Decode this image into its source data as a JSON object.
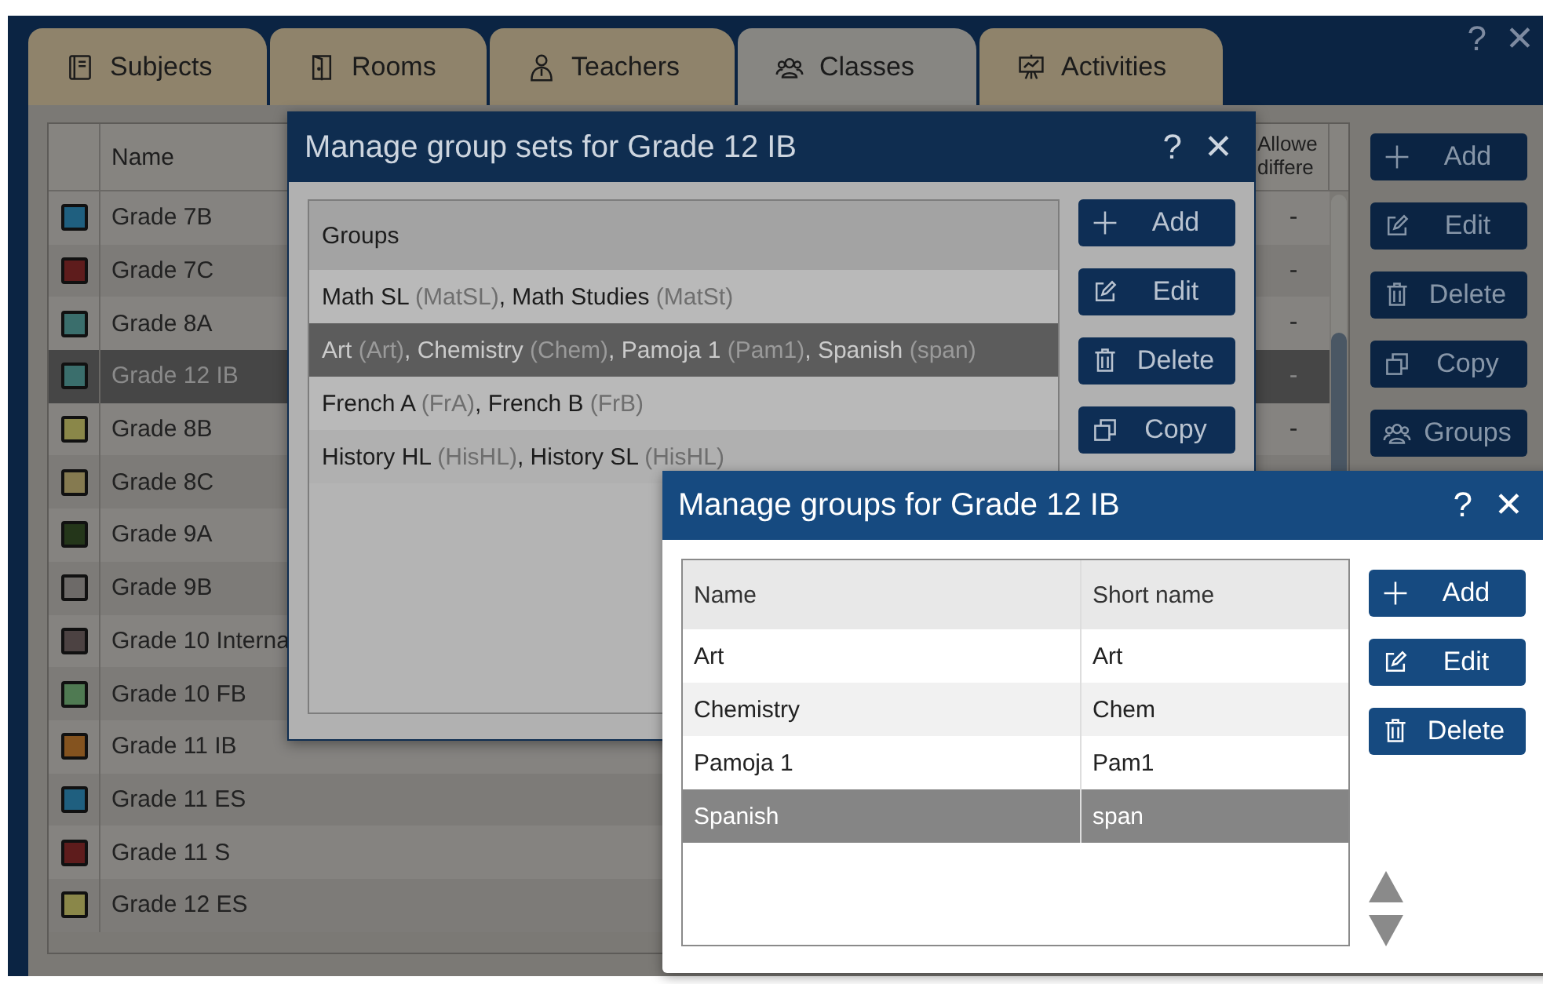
{
  "window": {
    "help": "?",
    "close": "✕"
  },
  "tabs": [
    {
      "label": "Subjects",
      "kind": "book",
      "selected": false
    },
    {
      "label": "Rooms",
      "kind": "door",
      "selected": false
    },
    {
      "label": "Teachers",
      "kind": "person",
      "selected": false
    },
    {
      "label": "Classes",
      "kind": "people",
      "selected": true
    },
    {
      "label": "Activities",
      "kind": "easel",
      "selected": false
    }
  ],
  "classes_table": {
    "columns": [
      "Name",
      "Allowe differe"
    ],
    "rows": [
      {
        "name": "Grade 7B",
        "color": "#1f5f7f",
        "selected": false,
        "column_2": "-"
      },
      {
        "name": "Grade 7C",
        "color": "#5e1c1c",
        "selected": false,
        "column_2": "-"
      },
      {
        "name": "Grade 8A",
        "color": "#3a6e6c",
        "selected": false,
        "column_2": "-"
      },
      {
        "name": "Grade 12 IB",
        "color": "#3a6e6c",
        "selected": true,
        "column_2": "-"
      },
      {
        "name": "Grade 8B",
        "color": "#8a8749",
        "selected": false,
        "column_2": "-"
      },
      {
        "name": "Grade 8C",
        "color": "#857a50",
        "selected": false
      },
      {
        "name": "Grade 9A",
        "color": "#24361a",
        "selected": false
      },
      {
        "name": "Grade 9B",
        "color": "#6d6a68",
        "selected": false
      },
      {
        "name": "Grade 10 Interna",
        "color": "#4c4242",
        "selected": false
      },
      {
        "name": "Grade 10 FB",
        "color": "#4f7a52",
        "selected": false
      },
      {
        "name": "Grade 11 IB",
        "color": "#84531f",
        "selected": false
      },
      {
        "name": "Grade 11 ES",
        "color": "#1f5f7f",
        "selected": false
      },
      {
        "name": "Grade 11 S",
        "color": "#5e1c1c",
        "selected": false
      },
      {
        "name": "Grade 12 ES",
        "color": "#8a8749",
        "selected": false
      }
    ]
  },
  "class_buttons": [
    {
      "label": "Add",
      "kind": "plus"
    },
    {
      "label": "Edit",
      "kind": "edit"
    },
    {
      "label": "Delete",
      "kind": "trash"
    },
    {
      "label": "Copy",
      "kind": "copy"
    },
    {
      "label": "Groups",
      "kind": "people"
    }
  ],
  "group_sets_dialog": {
    "title": "Manage group sets for Grade 12 IB",
    "help": "?",
    "close": "✕",
    "column": "Groups",
    "rows": [
      {
        "selected": false,
        "parts": [
          {
            "text": "Math SL ",
            "muted": false
          },
          {
            "text": "(MatSL)",
            "muted": true
          },
          {
            "text": ", Math Studies ",
            "muted": false
          },
          {
            "text": "(MatSt)",
            "muted": true
          }
        ]
      },
      {
        "selected": true,
        "parts": [
          {
            "text": "Art ",
            "muted": false
          },
          {
            "text": "(Art)",
            "muted": true
          },
          {
            "text": ", Chemistry ",
            "muted": false
          },
          {
            "text": "(Chem)",
            "muted": true
          },
          {
            "text": ", Pamoja 1 ",
            "muted": false
          },
          {
            "text": "(Pam1)",
            "muted": true
          },
          {
            "text": ", Spanish ",
            "muted": false
          },
          {
            "text": "(span)",
            "muted": true
          }
        ]
      },
      {
        "selected": false,
        "parts": [
          {
            "text": "French A ",
            "muted": false
          },
          {
            "text": "(FrA)",
            "muted": true
          },
          {
            "text": ", French B ",
            "muted": false
          },
          {
            "text": "(FrB)",
            "muted": true
          }
        ]
      },
      {
        "selected": false,
        "parts": [
          {
            "text": "History HL ",
            "muted": false
          },
          {
            "text": "(HisHL)",
            "muted": true
          },
          {
            "text": ", History SL ",
            "muted": false
          },
          {
            "text": "(HisHL)",
            "muted": true
          }
        ]
      }
    ],
    "buttons": [
      {
        "label": "Add",
        "kind": "plus"
      },
      {
        "label": "Edit",
        "kind": "edit"
      },
      {
        "label": "Delete",
        "kind": "trash"
      },
      {
        "label": "Copy",
        "kind": "copy"
      }
    ]
  },
  "groups_dialog": {
    "title": "Manage groups for Grade 12 IB",
    "help": "?",
    "close": "✕",
    "columns": [
      "Name",
      "Short name"
    ],
    "rows": [
      {
        "name": "Art",
        "short_name": "Art",
        "selected": false
      },
      {
        "name": "Chemistry",
        "short_name": "Chem",
        "selected": false
      },
      {
        "name": "Pamoja 1",
        "short_name": "Pam1",
        "selected": false
      },
      {
        "name": "Spanish",
        "short_name": "span",
        "selected": true
      }
    ],
    "buttons": [
      {
        "label": "Add",
        "kind": "plus"
      },
      {
        "label": "Edit",
        "kind": "edit"
      },
      {
        "label": "Delete",
        "kind": "trash"
      }
    ]
  }
}
